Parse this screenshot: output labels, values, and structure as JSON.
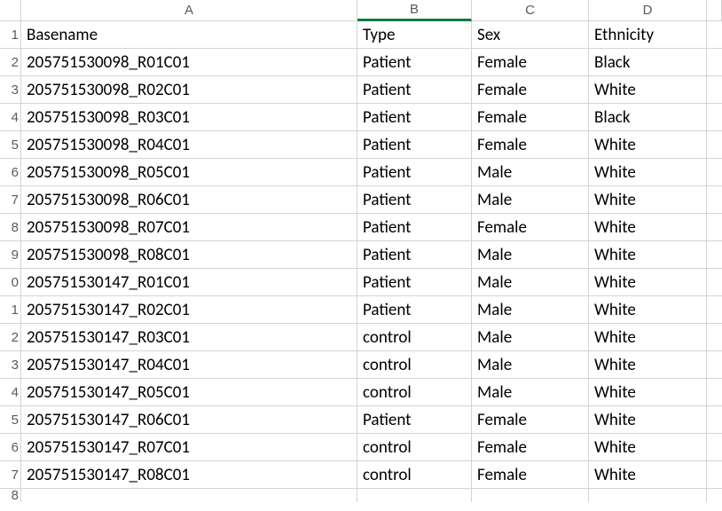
{
  "columns": {
    "A": "A",
    "B": "B",
    "C": "C",
    "D": "D"
  },
  "headers": {
    "basename": "Basename",
    "type": "Type",
    "sex": "Sex",
    "ethnicity": "Ethnicity"
  },
  "rows": [
    {
      "num": "1",
      "basename": "Basename",
      "type": "Type",
      "sex": "Sex",
      "ethnicity": "Ethnicity"
    },
    {
      "num": "2",
      "basename": "205751530098_R01C01",
      "type": "Patient",
      "sex": "Female",
      "ethnicity": "Black"
    },
    {
      "num": "3",
      "basename": "205751530098_R02C01",
      "type": "Patient",
      "sex": "Female",
      "ethnicity": "White"
    },
    {
      "num": "4",
      "basename": "205751530098_R03C01",
      "type": "Patient",
      "sex": "Female",
      "ethnicity": "Black"
    },
    {
      "num": "5",
      "basename": "205751530098_R04C01",
      "type": "Patient",
      "sex": "Female",
      "ethnicity": "White"
    },
    {
      "num": "6",
      "basename": "205751530098_R05C01",
      "type": "Patient",
      "sex": "Male",
      "ethnicity": "White"
    },
    {
      "num": "7",
      "basename": "205751530098_R06C01",
      "type": "Patient",
      "sex": "Male",
      "ethnicity": "White"
    },
    {
      "num": "8",
      "basename": "205751530098_R07C01",
      "type": "Patient",
      "sex": "Female",
      "ethnicity": "White"
    },
    {
      "num": "9",
      "basename": "205751530098_R08C01",
      "type": "Patient",
      "sex": "Male",
      "ethnicity": "White"
    },
    {
      "num": "0",
      "basename": "205751530147_R01C01",
      "type": "Patient",
      "sex": "Male",
      "ethnicity": "White"
    },
    {
      "num": "1",
      "basename": "205751530147_R02C01",
      "type": "Patient",
      "sex": "Male",
      "ethnicity": "White"
    },
    {
      "num": "2",
      "basename": "205751530147_R03C01",
      "type": "control",
      "sex": "Male",
      "ethnicity": "White"
    },
    {
      "num": "3",
      "basename": "205751530147_R04C01",
      "type": "control",
      "sex": "Male",
      "ethnicity": "White"
    },
    {
      "num": "4",
      "basename": "205751530147_R05C01",
      "type": "control",
      "sex": "Male",
      "ethnicity": "White"
    },
    {
      "num": "5",
      "basename": "205751530147_R06C01",
      "type": "Patient",
      "sex": "Female",
      "ethnicity": "White"
    },
    {
      "num": "6",
      "basename": "205751530147_R07C01",
      "type": "control",
      "sex": "Female",
      "ethnicity": "White"
    },
    {
      "num": "7",
      "basename": "205751530147_R08C01",
      "type": "control",
      "sex": "Female",
      "ethnicity": "White"
    },
    {
      "num": "8",
      "basename": "",
      "type": "",
      "sex": "",
      "ethnicity": ""
    }
  ]
}
